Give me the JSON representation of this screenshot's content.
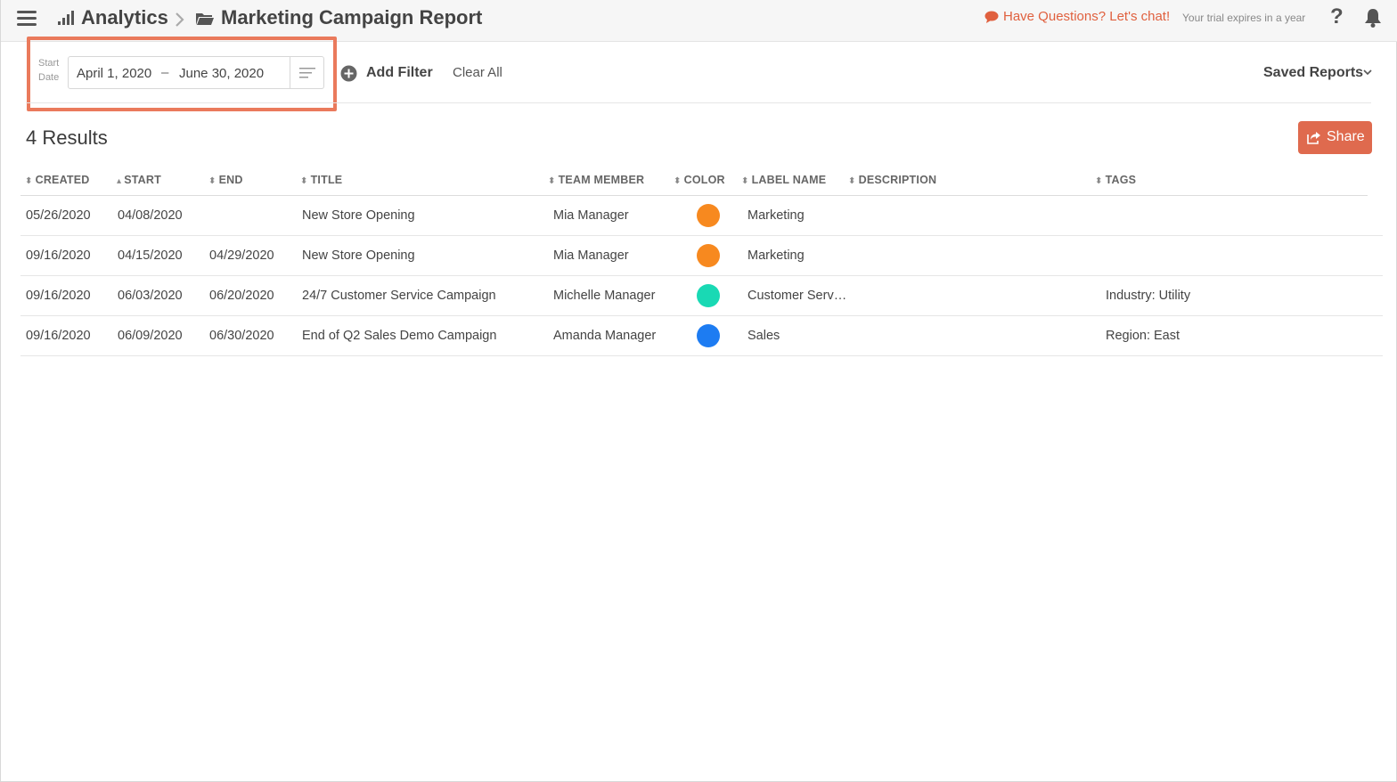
{
  "header": {
    "breadcrumb": [
      "Analytics",
      "Marketing Campaign Report"
    ],
    "chat_link": "Have Questions? Let's chat!",
    "trial_text": "Your trial expires in a year",
    "help_label": "?"
  },
  "filters": {
    "start_date_label_1": "Start",
    "start_date_label_2": "Date",
    "date_from": "April 1, 2020",
    "date_separator": "–",
    "date_to": "June 30, 2020",
    "add_filter": "Add Filter",
    "clear_all": "Clear All",
    "saved_reports": "Saved Reports"
  },
  "results": {
    "count_text": "4 Results",
    "share_label": "Share"
  },
  "table": {
    "columns": [
      {
        "label": "CREATED",
        "sort": "both"
      },
      {
        "label": "START",
        "sort": "asc"
      },
      {
        "label": "END",
        "sort": "both"
      },
      {
        "label": "TITLE",
        "sort": "both"
      },
      {
        "label": "TEAM MEMBER",
        "sort": "both"
      },
      {
        "label": "COLOR",
        "sort": "both"
      },
      {
        "label": "LABEL NAME",
        "sort": "both"
      },
      {
        "label": "DESCRIPTION",
        "sort": "both"
      },
      {
        "label": "TAGS",
        "sort": "both"
      }
    ],
    "rows": [
      {
        "created": "05/26/2020",
        "start": "04/08/2020",
        "end": "",
        "title": "New Store Opening",
        "team_member": "Mia Manager",
        "color": "#f7891f",
        "label_name": "Marketing",
        "description": "",
        "tags": ""
      },
      {
        "created": "09/16/2020",
        "start": "04/15/2020",
        "end": "04/29/2020",
        "title": "New Store Opening",
        "team_member": "Mia Manager",
        "color": "#f7891f",
        "label_name": "Marketing",
        "description": "",
        "tags": ""
      },
      {
        "created": "09/16/2020",
        "start": "06/03/2020",
        "end": "06/20/2020",
        "title": "24/7 Customer Service Campaign",
        "team_member": "Michelle Manager",
        "color": "#19d9b4",
        "label_name": "Customer Serv…",
        "description": "",
        "tags": "Industry: Utility"
      },
      {
        "created": "09/16/2020",
        "start": "06/09/2020",
        "end": "06/30/2020",
        "title": "End of Q2 Sales Demo Campaign",
        "team_member": "Amanda Manager",
        "color": "#1d7cf2",
        "label_name": "Sales",
        "description": "",
        "tags": "Region: East"
      }
    ]
  },
  "colors": {
    "accent": "#df6a4e",
    "highlight_border": "#ea7a5c",
    "chat_link": "#e0603e"
  },
  "icons": [
    "menu-icon",
    "bar-chart-icon",
    "chevron-right-icon",
    "folder-icon",
    "chat-bubble-icon",
    "help-icon",
    "bell-icon",
    "lines-menu-icon",
    "plus-circle-icon",
    "chevron-down-icon",
    "share-icon",
    "sort-icon"
  ]
}
